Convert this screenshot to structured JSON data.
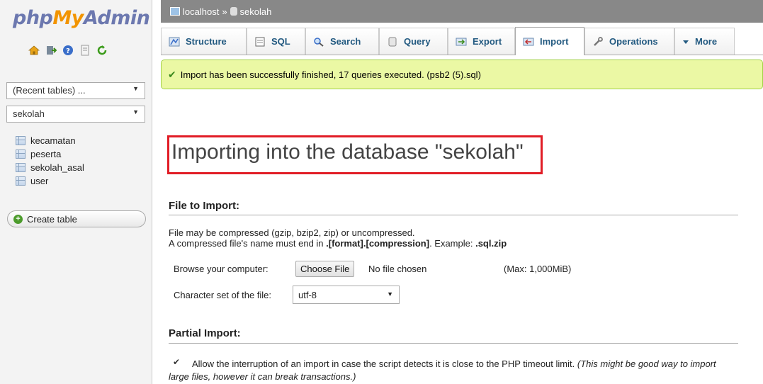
{
  "sidebar": {
    "logo": {
      "php": "php",
      "my": "My",
      "admin": "Admin"
    },
    "nav_icons": [
      "home-icon",
      "exit-icon",
      "help-icon",
      "docs-icon",
      "reload-icon"
    ],
    "recent_tables": "(Recent tables) ...",
    "database": "sekolah",
    "tables": [
      "kecamatan",
      "peserta",
      "sekolah_asal",
      "user"
    ],
    "create_table": "Create table"
  },
  "breadcrumb": {
    "server": "localhost",
    "separator": "»",
    "database": "sekolah"
  },
  "tabs": [
    {
      "label": "Structure",
      "icon": "structure-icon"
    },
    {
      "label": "SQL",
      "icon": "sql-icon"
    },
    {
      "label": "Search",
      "icon": "search-icon"
    },
    {
      "label": "Query",
      "icon": "query-icon"
    },
    {
      "label": "Export",
      "icon": "export-icon"
    },
    {
      "label": "Import",
      "icon": "import-icon",
      "active": true
    },
    {
      "label": "Operations",
      "icon": "wrench-icon"
    },
    {
      "label": "More",
      "icon": "dropdown-arrow-icon"
    }
  ],
  "success_message": "Import has been successfully finished, 17 queries executed. (psb2 (5).sql)",
  "heading": "Importing into the database \"sekolah\"",
  "file_import": {
    "title": "File to Import:",
    "line1": "File may be compressed (gzip, bzip2, zip) or uncompressed.",
    "line2_prefix": "A compressed file's name must end in ",
    "line2_format": ".[format].[compression]",
    "line2_mid": ". Example: ",
    "line2_example": ".sql.zip",
    "browse_label": "Browse your computer:",
    "choose_file": "Choose File",
    "no_file": "No file chosen",
    "max": "(Max: 1,000MiB)",
    "charset_label": "Character set of the file:",
    "charset_value": "utf-8"
  },
  "partial_import": {
    "title": "Partial Import:",
    "checkbox_checked": true,
    "text": "Allow the interruption of an import in case the script detects it is close to the PHP timeout limit.",
    "note": "(This might be good way to import large files, however it can break transactions.)"
  },
  "colors": {
    "success_bg": "#ebf8a4",
    "highlight_border": "#e11d26",
    "breadcrumb_bg": "#888888"
  }
}
